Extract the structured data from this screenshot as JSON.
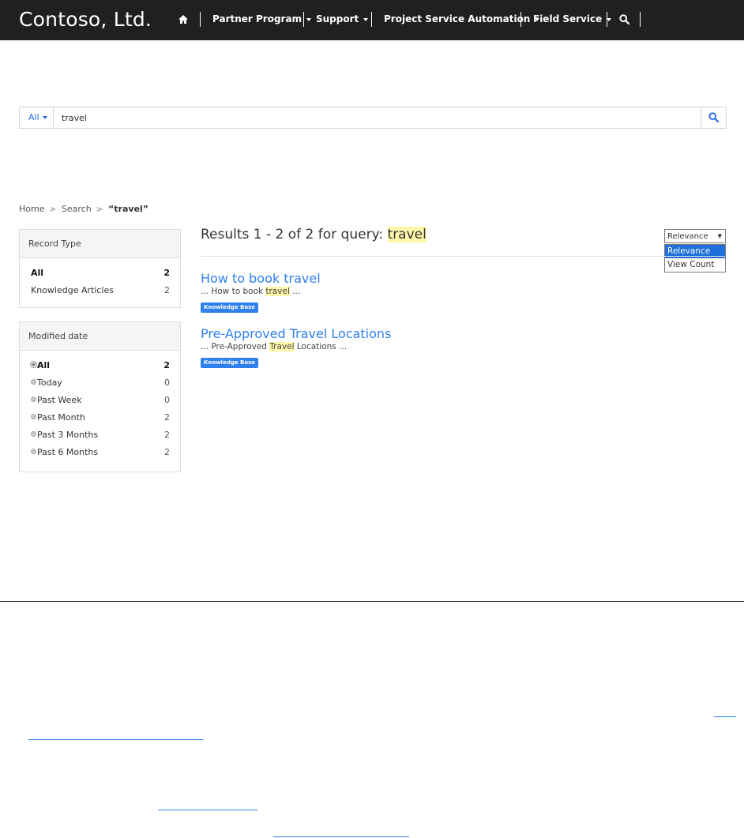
{
  "brand": "Contoso, Ltd.",
  "nav": {
    "items": [
      {
        "label": "Partner Program",
        "dropdown": true
      },
      {
        "label": "Support",
        "dropdown": true
      },
      {
        "label": "Project Service Automation",
        "dropdown": true
      },
      {
        "label": "Field Service",
        "dropdown": true
      }
    ],
    "icons": [
      "home-icon",
      "search-icon"
    ]
  },
  "search": {
    "filter_label": "All",
    "query": "travel",
    "button_icon": "search-icon"
  },
  "breadcrumb": {
    "home": "Home",
    "search": "Search",
    "current": "“travel”"
  },
  "facets": {
    "record_type": {
      "title": "Record Type",
      "items": [
        {
          "label": "All",
          "count": "2",
          "selected": true
        },
        {
          "label": "Knowledge Articles",
          "count": "2",
          "selected": false
        }
      ]
    },
    "modified_date": {
      "title": "Modified date",
      "items": [
        {
          "label": "All",
          "count": "2",
          "selected": true
        },
        {
          "label": "Today",
          "count": "0",
          "selected": false
        },
        {
          "label": "Past Week",
          "count": "0",
          "selected": false
        },
        {
          "label": "Past Month",
          "count": "2",
          "selected": false
        },
        {
          "label": "Past 3 Months",
          "count": "2",
          "selected": false
        },
        {
          "label": "Past 6 Months",
          "count": "2",
          "selected": false
        }
      ]
    }
  },
  "results": {
    "summary_prefix": "Results 1 - 2 of 2 for query:",
    "query": "travel",
    "sort": {
      "selected": "Relevance",
      "options": [
        "Relevance",
        "View Count"
      ]
    },
    "items": [
      {
        "title": "How to book travel",
        "snippet_before": "... How to book ",
        "snippet_highlight": "travel",
        "snippet_after": " ...",
        "badge": "Knowledge Base"
      },
      {
        "title": "Pre-Approved Travel Locations",
        "snippet_before": "... Pre-Approved ",
        "snippet_highlight": "Travel",
        "snippet_after": " Locations ...",
        "badge": "Knowledge Base"
      }
    ]
  },
  "colors": {
    "navbar": "#202020",
    "link": "#2f80ed",
    "highlight": "#fff7a8",
    "selected_option": "#1e6fd9"
  }
}
